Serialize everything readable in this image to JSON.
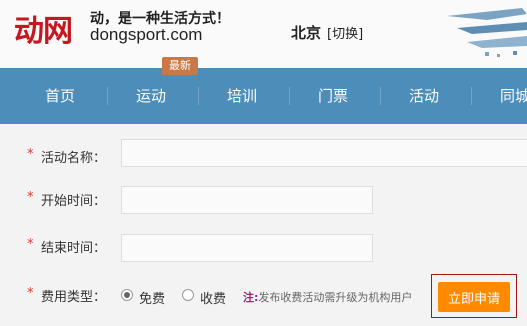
{
  "header": {
    "logo_text": "动网",
    "slogan": "动，是一种生活方式！",
    "domain": "dongsport.com",
    "city": "北京",
    "switch_label": "[切换]"
  },
  "nav": {
    "items": [
      "首页",
      "运动",
      "培训",
      "门票",
      "活动",
      "同城"
    ],
    "badge": "最新"
  },
  "form": {
    "required_mark": "*",
    "activity_name_label": "活动名称：",
    "start_time_label": "开始时间：",
    "end_time_label": "结束时间：",
    "fee_type_label": "费用类型：",
    "fee_options": [
      "免费",
      "收费"
    ],
    "fee_selected": "免费",
    "note_prefix": "注:",
    "note_text": "发布收费活动需升级为机构用户",
    "apply_button": "立即申请"
  },
  "colors": {
    "brand_red": "#c8161d",
    "nav_blue": "#4c8dba",
    "button_orange": "#ff8a00"
  }
}
